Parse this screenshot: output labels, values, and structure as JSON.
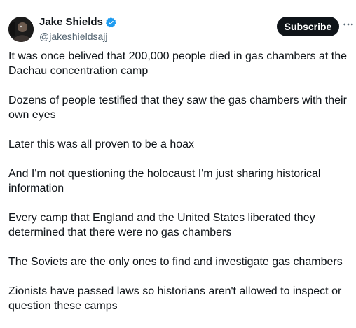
{
  "author": {
    "display_name": "Jake Shields",
    "handle": "@jakeshieldsajj",
    "verified": true,
    "verified_color": "#1d9bf0"
  },
  "actions": {
    "subscribe_label": "Subscribe",
    "more_icon": "more-horizontal-icon"
  },
  "post": {
    "paragraphs": [
      "It was once belived that 200,000 people died in gas chambers at the Dachau concentration camp",
      "Dozens of people testified that they saw the gas chambers with their own eyes",
      "Later this was all proven to be a hoax",
      "And I'm not questioning the holocaust I'm just sharing historical information",
      "Every camp that England and the United States liberated they determined that there were no gas chambers",
      "The Soviets are the only ones to find and investigate gas chambers",
      "Zionists have passed laws so historians aren't allowed to inspect or question these camps"
    ]
  }
}
